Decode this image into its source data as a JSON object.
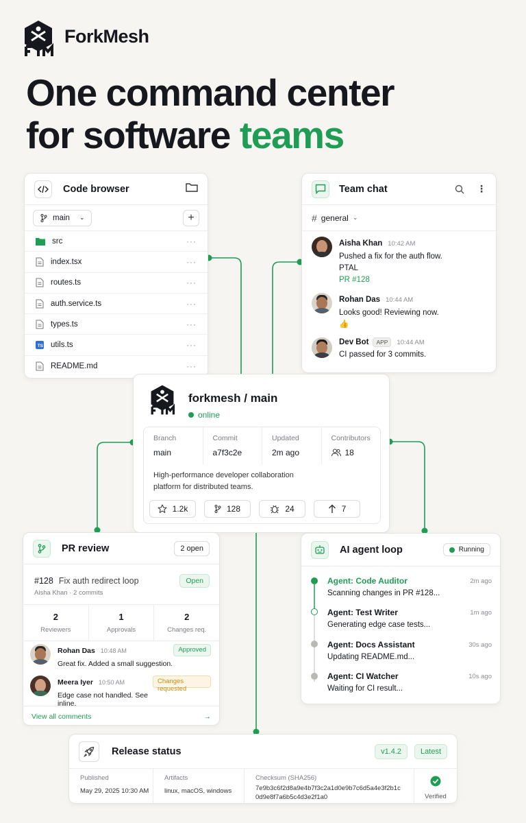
{
  "brand": {
    "name": "ForkMesh"
  },
  "hero": {
    "line1": "One command center",
    "line2_prefix": "for software ",
    "line2_accent": "teams"
  },
  "colors": {
    "accent": "#1f9d55",
    "text": "#16181d",
    "background": "#f6f5f1",
    "warning": "#c98a0e"
  },
  "code_browser": {
    "title": "Code browser",
    "branch": "main",
    "files": [
      {
        "name": "src",
        "icon": "folder-icon"
      },
      {
        "name": "index.tsx",
        "icon": "file-icon"
      },
      {
        "name": "routes.ts",
        "icon": "file-icon"
      },
      {
        "name": "auth.service.ts",
        "icon": "file-icon"
      },
      {
        "name": "types.ts",
        "icon": "file-icon"
      },
      {
        "name": "utils.ts",
        "icon": "ts-file-icon",
        "badge": "TS"
      },
      {
        "name": "README.md",
        "icon": "file-icon"
      }
    ],
    "more": "···"
  },
  "team_chat": {
    "title": "Team chat",
    "channel": "general",
    "messages": [
      {
        "name": "Aisha Khan",
        "time": "10:42 AM",
        "line1": "Pushed a fix for the auth flow.",
        "line2": "PTAL",
        "link": "PR #128"
      },
      {
        "name": "Rohan Das",
        "time": "10:44 AM",
        "line1": "Looks good! Reviewing now.",
        "emoji": "👍"
      },
      {
        "name": "Dev Bot",
        "badge": "APP",
        "time": "10:44 AM",
        "line1": "CI passed for 3 commits."
      }
    ]
  },
  "repo": {
    "title": "forkmesh / main",
    "status": "online",
    "stats": [
      {
        "label": "Branch",
        "value": "main"
      },
      {
        "label": "Commit",
        "value": "a7f3c2e"
      },
      {
        "label": "Updated",
        "value": "2m ago"
      },
      {
        "label": "Contributors",
        "value": "18"
      }
    ],
    "description_line1": "High-performance developer collaboration",
    "description_line2": "platform for distributed teams.",
    "counters": {
      "stars": "1.2k",
      "forks": "128",
      "issues": "24",
      "uploads": "7"
    }
  },
  "pr_review": {
    "title": "PR review",
    "open_count": "2 open",
    "number": "#128",
    "pr_title": "Fix auth redirect loop",
    "state": "Open",
    "author": "Aisha Khan",
    "commits": "2 commits",
    "separator": "·",
    "stats": [
      {
        "value": "2",
        "label": "Reviewers"
      },
      {
        "value": "1",
        "label": "Approvals"
      },
      {
        "value": "2",
        "label": "Changes req."
      }
    ],
    "reviews": [
      {
        "name": "Rohan Das",
        "time": "10:48 AM",
        "text": "Great fix. Added a small suggestion.",
        "badge": "Approved"
      },
      {
        "name": "Meera Iyer",
        "time": "10:50 AM",
        "text": "Edge case not handled. See inline.",
        "badge": "Changes requested"
      }
    ],
    "view_all": "View all comments",
    "arrow": "→"
  },
  "ai_loop": {
    "title": "AI agent loop",
    "status": "Running",
    "agents": [
      {
        "name": "Agent: Code Auditor",
        "desc": "Scanning changes in PR #128...",
        "time": "2m ago"
      },
      {
        "name": "Agent: Test Writer",
        "desc": "Generating edge case tests...",
        "time": "1m ago"
      },
      {
        "name": "Agent: Docs Assistant",
        "desc": "Updating README.md...",
        "time": "30s ago"
      },
      {
        "name": "Agent: CI Watcher",
        "desc": "Waiting for CI result...",
        "time": "10s ago"
      }
    ]
  },
  "release": {
    "title": "Release status",
    "version": "v1.4.2",
    "tag": "Latest",
    "published_label": "Published",
    "published_value": "May 29, 2025 10:30 AM",
    "artifacts_label": "Artifacts",
    "artifacts_value": "linux, macOS, windows",
    "checksum_label": "Checksum (SHA256)",
    "checksum_line1": "7e9b3c6f2d8a9e4b7f3c2a1d0e9b7c6d5a4e3f2b1c",
    "checksum_line2": "0d9e8f7a6b5c4d3e2f1a0",
    "verified": "Verified"
  }
}
